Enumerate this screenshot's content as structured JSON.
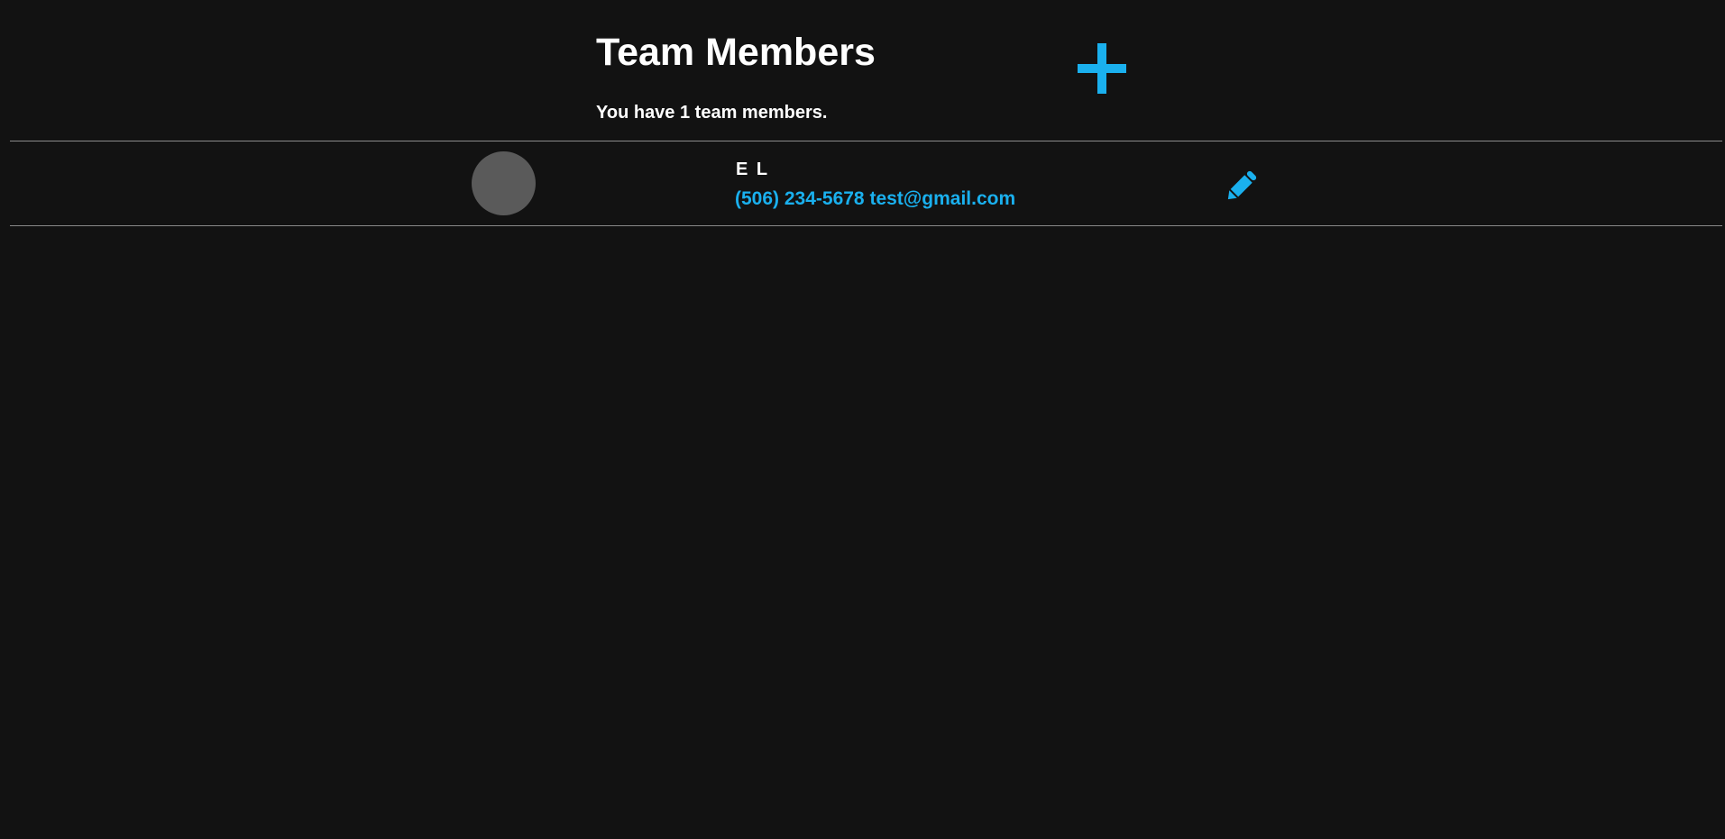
{
  "header": {
    "title": "Team Members",
    "member_count_text": "You have 1 team members."
  },
  "icons": {
    "add": "plus-icon",
    "edit": "pencil-icon"
  },
  "colors": {
    "background": "#121212",
    "accent": "#1ab0ee",
    "divider": "#8a8a8a",
    "avatar": "#5a5a5a",
    "text": "#ffffff"
  },
  "members": [
    {
      "name": "E L",
      "phone": "(506) 234-5678",
      "email": "test@gmail.com"
    }
  ]
}
